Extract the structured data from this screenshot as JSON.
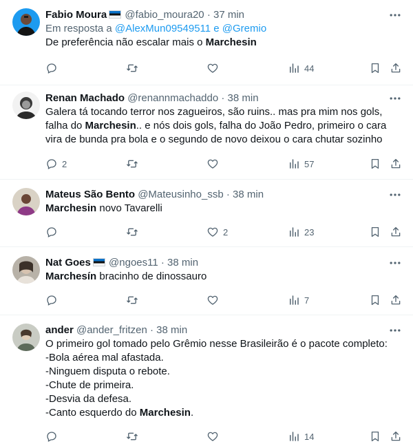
{
  "tweets": [
    {
      "name": "Fabio Moura",
      "handle": "@fabio_moura20",
      "time": "37 min",
      "reply_prefix": "Em resposta a",
      "reply_link": "@AlexMun09549511 e @Gremio",
      "text_pre": "De preferência não escalar mais o ",
      "text_bold": "Marchesin",
      "replies": "",
      "retweets": "",
      "likes": "",
      "views": "44"
    },
    {
      "name": "Renan Machado",
      "handle": "@renannmachaddo",
      "time": "38 min",
      "line1": "Galera tá tocando terror nos zagueiros, são ruins.. mas pra mim nos gols,",
      "line2_pre": "falha do ",
      "line2_bold": "Marchesin",
      "line2_post": ".. e nós dois gols, falha do João Pedro, primeiro o cara",
      "line3": "vira de bunda pra bola e o segundo de novo deixou o cara chutar sozinho",
      "replies": "2",
      "retweets": "",
      "likes": "",
      "views": "57"
    },
    {
      "name": "Mateus São Bento",
      "handle": "@Mateusinho_ssb",
      "time": "38 min",
      "text_bold": "Marchesin",
      "text_post": " novo Tavarelli",
      "replies": "",
      "retweets": "",
      "likes": "2",
      "views": "23"
    },
    {
      "name": "Nat Goes",
      "handle": "@ngoes11",
      "time": "38 min",
      "text_bold": "Marchesín",
      "text_post": " bracinho de dinossauro",
      "replies": "",
      "retweets": "",
      "likes": "",
      "views": "7"
    },
    {
      "name": "ander",
      "handle": "@ander_fritzen",
      "time": "38 min",
      "line1": "O primeiro gol tomado pelo Grêmio nesse Brasileirão é o pacote completo:",
      "line2": "-Bola aérea mal afastada.",
      "line3": "-Ninguem disputa o rebote.",
      "line4": "-Chute de primeira.",
      "line5": "-Desvia da defesa.",
      "line6_pre": "-Canto esquerdo do ",
      "line6_bold": "Marchesin",
      "line6_post": ".",
      "replies": "",
      "retweets": "",
      "likes": "",
      "views": "14"
    }
  ],
  "separator": "·",
  "colors": {
    "text": "#0f1419",
    "secondary": "#536471",
    "link": "#1d9bf0",
    "border": "#eff3f4"
  },
  "icons": [
    "more-icon",
    "reply-icon",
    "retweet-icon",
    "like-icon",
    "views-icon",
    "bookmark-icon",
    "share-icon"
  ]
}
